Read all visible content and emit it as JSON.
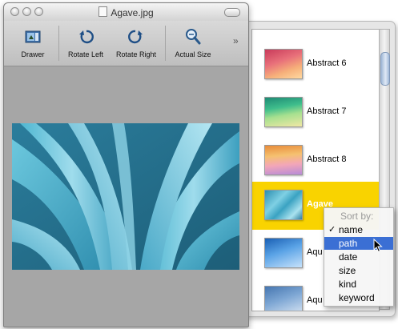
{
  "window": {
    "title": "Agave.jpg"
  },
  "toolbar": {
    "items": [
      {
        "label": "Drawer",
        "icon": "drawer-icon"
      },
      {
        "label": "Rotate Left",
        "icon": "rotate-left-icon"
      },
      {
        "label": "Rotate Right",
        "icon": "rotate-right-icon"
      },
      {
        "label": "Actual Size",
        "icon": "magnifier-icon"
      }
    ],
    "overflow": "»"
  },
  "drawer": {
    "items": [
      {
        "label": "Abstract 6",
        "selected": false
      },
      {
        "label": "Abstract 7",
        "selected": false
      },
      {
        "label": "Abstract 8",
        "selected": false
      },
      {
        "label": "Agave",
        "selected": true
      },
      {
        "label": "Aqu",
        "selected": false
      },
      {
        "label": "Aqu",
        "selected": false
      }
    ]
  },
  "sort_menu": {
    "header": "Sort by:",
    "options": [
      "name",
      "path",
      "date",
      "size",
      "kind",
      "keyword"
    ],
    "checked": "name",
    "highlighted": "path",
    "check_mark": "✓"
  },
  "colors": {
    "selection": "#f9d300",
    "menu_highlight": "#3b6fd4",
    "viewer_background": "#a6a6a6"
  }
}
